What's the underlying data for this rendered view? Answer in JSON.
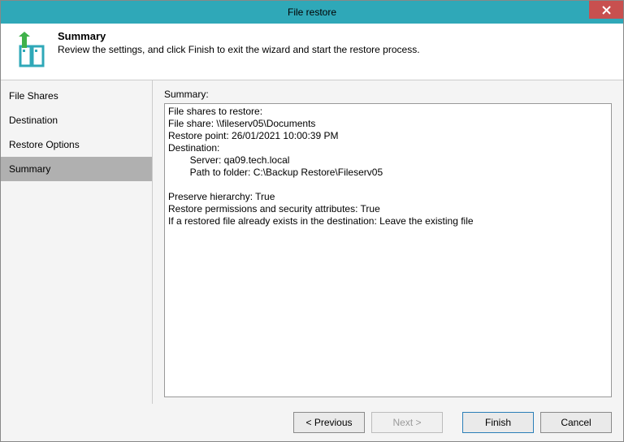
{
  "window": {
    "title": "File restore"
  },
  "header": {
    "title": "Summary",
    "desc": "Review the settings, and click Finish to exit the wizard and start the restore process."
  },
  "sidebar": {
    "items": [
      {
        "label": "File Shares"
      },
      {
        "label": "Destination"
      },
      {
        "label": "Restore Options"
      },
      {
        "label": "Summary"
      }
    ],
    "activeIndex": 3
  },
  "main": {
    "label": "Summary:",
    "lines": [
      "File shares to restore:",
      "File share: \\\\fileserv05\\Documents",
      "Restore point: 26/01/2021 10:00:39 PM",
      "Destination:",
      "        Server: qa09.tech.local",
      "        Path to folder: C:\\Backup Restore\\Fileserv05",
      "",
      "Preserve hierarchy: True",
      "Restore permissions and security attributes: True",
      "If a restored file already exists in the destination: Leave the existing file"
    ]
  },
  "footer": {
    "previous": "< Previous",
    "next": "Next >",
    "finish": "Finish",
    "cancel": "Cancel"
  }
}
